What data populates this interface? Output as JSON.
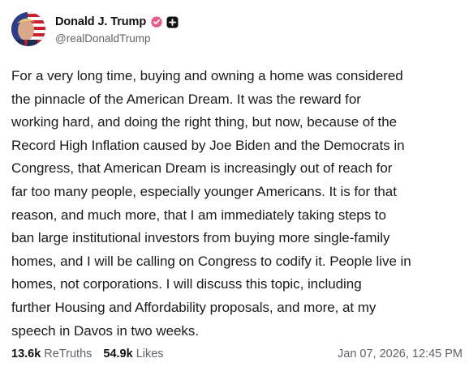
{
  "author": {
    "display_name": "Donald J. Trump",
    "handle": "@realDonaldTrump",
    "verified_icon": "verified-badge-icon",
    "plus_icon": "plus-badge-icon",
    "verified_color": "#e05a8c"
  },
  "post": {
    "text": "For a very long time, buying and owning a home was considered\nthe pinnacle of the American Dream. It was the reward for\nworking hard, and doing the right thing, but now, because of the\nRecord High Inflation caused by Joe Biden and the Democrats in\nCongress, that American Dream is increasingly out of reach for\nfar too many people, especially younger Americans. It is for that\nreason, and much more, that I am immediately taking steps to\nban large institutional investors from buying more single-family\nhomes, and I will be calling on Congress to codify it. People live in\nhomes, not corporations. I will discuss this topic, including\nfurther Housing and Affordability proposals, and more, at my\nspeech in Davos in two weeks."
  },
  "stats": {
    "retruths_count": "13.6k",
    "retruths_label": "ReTruths",
    "likes_count": "54.9k",
    "likes_label": "Likes"
  },
  "timestamp": "Jan 07, 2026, 12:45 PM"
}
